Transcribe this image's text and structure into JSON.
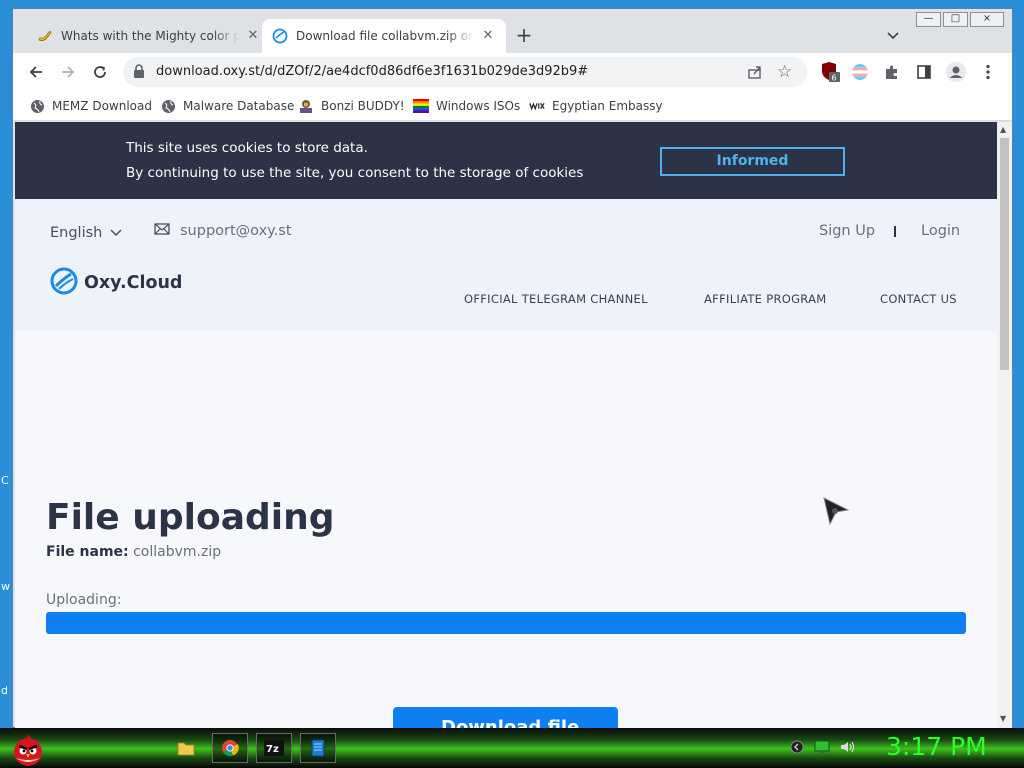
{
  "tabs": [
    {
      "title": "Whats with the Mighty color palette",
      "favicon": "banana-icon"
    },
    {
      "title": "Download file collabvm.zip on Oxy.Cloud",
      "favicon": "oxy-cloud-icon"
    }
  ],
  "window_controls": {
    "minimize": "—",
    "maximize": "□",
    "close": "×"
  },
  "address_bar": {
    "url": "download.oxy.st/d/dZOf/2/ae4dcf0d86df6e3f1631b029de3d92b9#"
  },
  "extensions": {
    "ublock_badge": "6"
  },
  "bookmarks": [
    {
      "label": "MEMZ Download",
      "icon": "globe-icon"
    },
    {
      "label": "Malware Database",
      "icon": "globe-icon"
    },
    {
      "label": "Bonzi BUDDY!",
      "icon": "bonzi-icon"
    },
    {
      "label": "Windows ISOs",
      "icon": "rainbow-flag-icon"
    },
    {
      "label": "Egyptian Embassy",
      "icon": "wix-icon"
    }
  ],
  "cookie_banner": {
    "line1": "This site uses cookies to store data.",
    "line2": "By continuing to use the site, you consent to the storage of cookies",
    "button": "Informed"
  },
  "header": {
    "language": "English",
    "support_email": "support@oxy.st",
    "sign_up": "Sign Up",
    "login": "Login",
    "logo_text": "Oxy.Cloud",
    "nav": [
      "OFFICIAL TELEGRAM CHANNEL",
      "AFFILIATE PROGRAM",
      "CONTACT US"
    ]
  },
  "main": {
    "heading": "File uploading",
    "file_name_label": "File name:",
    "file_name": "collabvm.zip",
    "uploading_label": "Uploading:",
    "progress": 1.0,
    "download_button": "Download file"
  },
  "desktop_fragments": [
    "...",
    "C",
    "w",
    "d"
  ],
  "taskbar": {
    "clock": "3:17 PM",
    "items": [
      "folder-icon",
      "chrome-icon",
      "7zip-icon",
      "notepad-icon"
    ]
  },
  "colors": {
    "accent": "#0d7ff0",
    "cookie_bg": "#2d3347",
    "cookie_button": "#4db3f0",
    "clock": "#2aff2a"
  }
}
